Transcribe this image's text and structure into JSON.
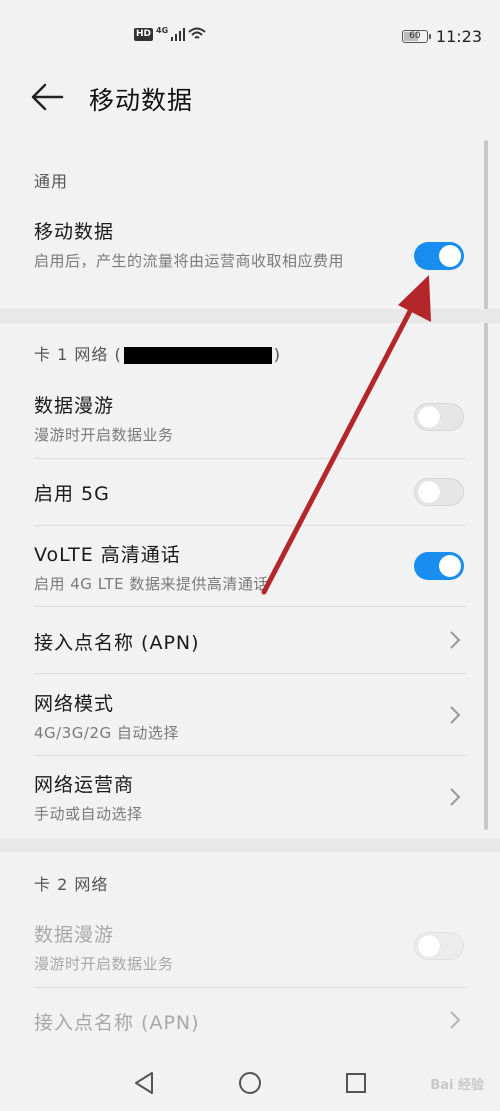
{
  "status_bar": {
    "hd_badge": "HD",
    "network_type": "4G",
    "battery_level": "60",
    "time": "11:23"
  },
  "header": {
    "title": "移动数据",
    "back_icon": "arrow-left-icon"
  },
  "general_section": {
    "label": "通用",
    "mobile_data": {
      "title": "移动数据",
      "subtitle": "启用后，产生的流量将由运营商收取相应费用",
      "enabled": true
    }
  },
  "sim1_section": {
    "label_prefix": "卡 1 网络 (",
    "label_suffix": ")",
    "rows": [
      {
        "title": "数据漫游",
        "subtitle": "漫游时开启数据业务",
        "toggle": false
      },
      {
        "title": "启用 5G",
        "subtitle": "",
        "toggle": false
      },
      {
        "title": "VoLTE 高清通话",
        "subtitle": "启用 4G LTE 数据来提供高清通话",
        "toggle": true
      },
      {
        "title": "接入点名称 (APN)",
        "subtitle": ""
      },
      {
        "title": "网络模式",
        "subtitle": "4G/3G/2G 自动选择"
      },
      {
        "title": "网络运营商",
        "subtitle": "手动或自动选择"
      }
    ]
  },
  "sim2_section": {
    "label": "卡 2 网络",
    "rows": [
      {
        "title": "数据漫游",
        "subtitle": "漫游时开启数据业务",
        "toggle": false
      },
      {
        "title": "接入点名称 (APN)",
        "subtitle": ""
      }
    ]
  },
  "nav_bar": {
    "back_icon": "triangle-back-icon",
    "home_icon": "circle-home-icon",
    "recents_icon": "square-recents-icon"
  },
  "watermark": "Bai 经验",
  "colors": {
    "accent": "#1a8ef0",
    "annotation_arrow": "#b3262a",
    "background": "#f2f2f2"
  }
}
